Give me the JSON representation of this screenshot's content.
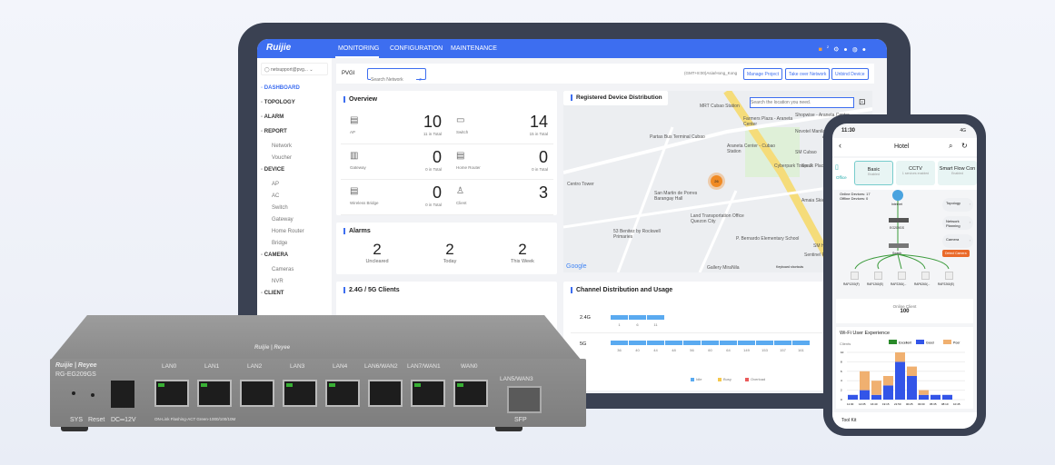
{
  "tablet": {
    "brand": "Ruijie",
    "nav": [
      "MONITORING",
      "CONFIGURATION",
      "MAINTENANCE"
    ],
    "notification_count": "2",
    "account": "netsupport@pvg...",
    "sidebar": [
      {
        "label": "DASHBOARD",
        "type": "main",
        "active": true
      },
      {
        "label": "TOPOLOGY",
        "type": "main"
      },
      {
        "label": "ALARM",
        "type": "main"
      },
      {
        "label": "REPORT",
        "type": "main"
      },
      {
        "label": "Network",
        "type": "sub"
      },
      {
        "label": "Voucher",
        "type": "sub"
      },
      {
        "label": "DEVICE",
        "type": "main"
      },
      {
        "label": "AP",
        "type": "sub"
      },
      {
        "label": "AC",
        "type": "sub"
      },
      {
        "label": "Switch",
        "type": "sub"
      },
      {
        "label": "Gateway",
        "type": "sub"
      },
      {
        "label": "Home Router",
        "type": "sub"
      },
      {
        "label": "Bridge",
        "type": "sub"
      },
      {
        "label": "CAMERA",
        "type": "main"
      },
      {
        "label": "Cameras",
        "type": "sub"
      },
      {
        "label": "NVR",
        "type": "sub"
      },
      {
        "label": "CLIENT",
        "type": "main"
      }
    ],
    "toolbar": {
      "project": "PVGI",
      "search_placeholder": "Search Network",
      "timezone": "(GMT+8:00)Asia/Hong_Kong",
      "buttons": [
        "Manage Project",
        "Take over Network",
        "Unbind Device"
      ]
    },
    "overview": {
      "title": "Overview",
      "items": [
        {
          "label": "AP",
          "value": "10",
          "sub": "11 in Total"
        },
        {
          "label": "Switch",
          "value": "14",
          "sub": "15 in Total"
        },
        {
          "label": "Gateway",
          "value": "0",
          "sub": "0 in Total"
        },
        {
          "label": "Home Router",
          "value": "0",
          "sub": "0 in Total"
        },
        {
          "label": "Wireless Bridge",
          "value": "0",
          "sub": "0 in Total"
        },
        {
          "label": "Client",
          "value": "3",
          "sub": ""
        }
      ]
    },
    "map": {
      "title": "Registered Device Distribution",
      "search_placeholder": "Search the location you need.",
      "cluster": "26",
      "labels": [
        "MRT Cubao Station",
        "Farmers Plaza - Araneta Center",
        "Shopwise - Araneta Center",
        "Novotel Manila Araneta City",
        "Partas Bus Terminal Cubao",
        "Araneta Center - Cubao Station",
        "Ali Mall",
        "SM Cubao",
        "Cyberpark Tower 2",
        "Spark Place",
        "Centro Tower",
        "San Martin de Porres Barangay Hall",
        "Land Transportation Office Quezon City",
        "Amaia Skies Cubao Tower 2",
        "53 Benitez by Rockwell Primaries",
        "P. Bernardo Elementary School",
        "Gallery MiraNila",
        "SM Hypermarket",
        "Sentinel Residences",
        "Keyboard shortcuts",
        "Map"
      ],
      "google": "Google"
    },
    "alarms": {
      "title": "Alarms",
      "items": [
        {
          "value": "2",
          "label": "Uncleared"
        },
        {
          "value": "2",
          "label": "Today"
        },
        {
          "value": "2",
          "label": "This Week"
        }
      ]
    },
    "clients": {
      "title": "2.4G / 5G Clients"
    },
    "channel": {
      "title": "Channel Distribution and Usage",
      "band24": "2.4G",
      "ch24": [
        "1",
        "6",
        "11"
      ],
      "band5": "5G",
      "ch5": [
        "36",
        "40",
        "44",
        "48",
        "56",
        "60",
        "64",
        "149",
        "153",
        "157",
        "161"
      ],
      "legend": [
        "Idle",
        "Busy",
        "Overload"
      ],
      "colors": {
        "idle": "#5aaaf0",
        "busy": "#f5c84c",
        "overload": "#ea5a5a"
      }
    }
  },
  "phone": {
    "time": "11:30",
    "network": "4G",
    "title": "Hotel",
    "side_tab": "Office",
    "services": [
      {
        "name": "Basic",
        "status": "Enabled"
      },
      {
        "name": "CCTV",
        "status": "1 services enabled"
      },
      {
        "name": "Smart Flow Con",
        "status": "Enabled"
      }
    ],
    "online_devices": "Online Devices: 17",
    "offline_devices": "Offline Devices: 0",
    "topo": {
      "internet": "Internet",
      "gateway": "EG209GS",
      "switch": "Switch",
      "aps": [
        "RAP1200(F)",
        "RAP1260(E)",
        "RAP2260(...",
        "RAP6260(...",
        "RAP2260(E)"
      ]
    },
    "actions": [
      "Topology",
      "Network Planning",
      "Camera"
    ],
    "detect_camera": "Detect Camera",
    "online_client_label": "Online Client",
    "online_client_value": "100",
    "wifi_title": "Wi-Fi User Experience",
    "clients_label": "Clients",
    "legend": [
      "Excellent",
      "Good",
      "Poor"
    ],
    "chart_data": {
      "type": "bar",
      "x": [
        "11:30",
        "14:05",
        "16:40",
        "19:15",
        "21:50",
        "00:25",
        "03:00",
        "05:35",
        "08:10",
        "10:45"
      ],
      "yticks": [
        "0",
        "2",
        "4",
        "6",
        "8",
        "10"
      ],
      "series": [
        {
          "name": "Good",
          "values": [
            1,
            2,
            1,
            3,
            8,
            5,
            1,
            1,
            1,
            0
          ]
        },
        {
          "name": "Poor",
          "values": [
            0,
            4,
            3,
            2,
            2,
            2,
            1,
            0,
            0,
            0
          ]
        }
      ]
    },
    "toolkit": "Tool Kit"
  },
  "router": {
    "brand": "Ruijie | Reyee",
    "model": "RG-EG209GS",
    "top_logo": "Ruijie | Reyee",
    "ports": [
      "LAN0",
      "LAN1",
      "LAN2",
      "LAN3",
      "LAN4",
      "LAN6/WAN2",
      "LAN7/WAN1",
      "WAN0"
    ],
    "port_leds": [
      true,
      true,
      false,
      true,
      true,
      false,
      true,
      true
    ],
    "sfp_top": "LAN5/WAN3",
    "sfp_bottom": "SFP",
    "sys": "SYS",
    "reset": "Reset",
    "dc": "DC═12V",
    "legend": "ON-Link Flashing-ACT Green-1000/100/10M"
  }
}
